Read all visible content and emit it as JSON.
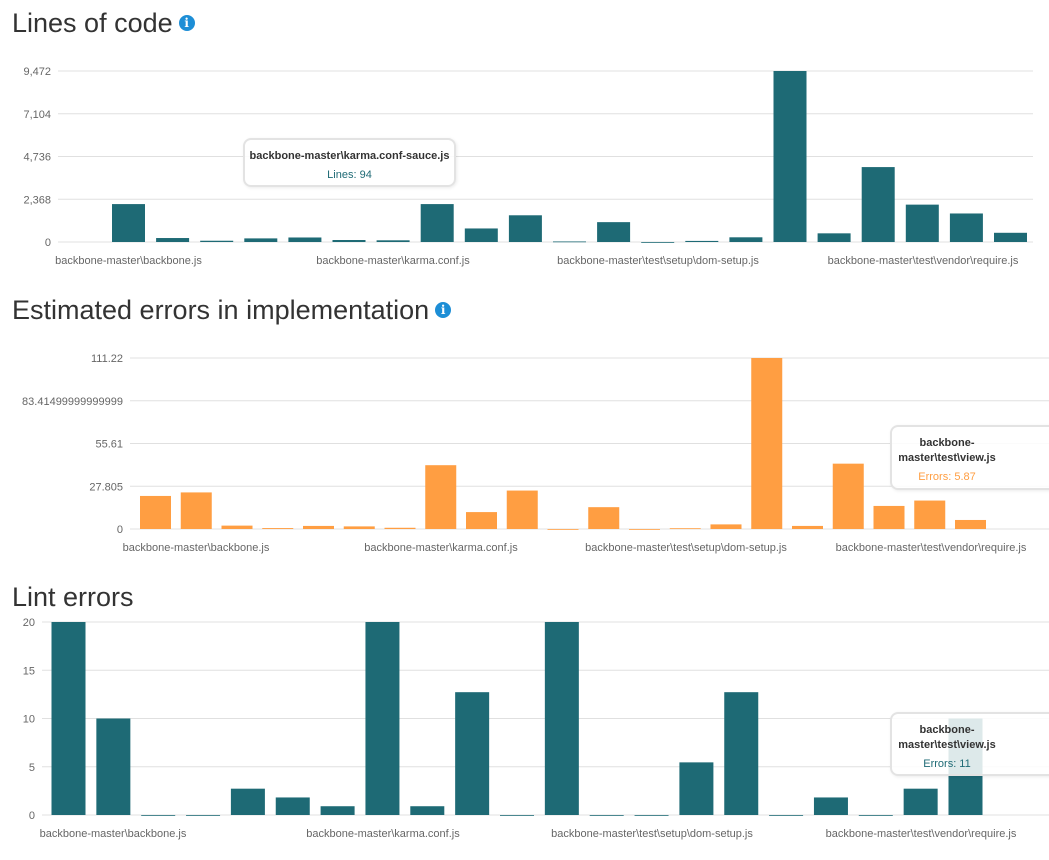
{
  "colors": {
    "teal": "#1e6a75",
    "orange": "#ff9e42",
    "info": "#1d8ed6"
  },
  "sections": {
    "loc": {
      "title": "Lines of code",
      "info_icon": "info-icon"
    },
    "err": {
      "title": "Estimated errors in implementation",
      "info_icon": "info-icon"
    },
    "lint": {
      "title": "Lint errors"
    }
  },
  "tooltips": {
    "loc": {
      "title": "backbone-master\\karma.conf-sauce.js",
      "label": "Lines: 94"
    },
    "err": {
      "title": "backbone-master\\test\\view.js",
      "label": "Errors: 5.87"
    },
    "lint": {
      "title": "backbone-master\\test\\view.js",
      "label": "Errors: 11"
    }
  },
  "chart_data": [
    {
      "type": "bar",
      "title": "Lines of code",
      "color": "#1e6a75",
      "y_ticks": [
        "9,472",
        "7,104",
        "4,736",
        "2,368",
        "0"
      ],
      "ylim": [
        0,
        9472
      ],
      "x_tick_labels": [
        "backbone-master\\backbone.js",
        "backbone-master\\karma.conf.js",
        "backbone-master\\test\\setup\\dom-setup.js",
        "backbone-master\\test\\vendor\\require.js"
      ],
      "categories": [
        "backbone-master\\backbone.js",
        "",
        "",
        "",
        "",
        "",
        "backbone-master\\karma.conf-sauce.js",
        "backbone-master\\karma.conf.js",
        "",
        "",
        "",
        "",
        "",
        "",
        "",
        "backbone-master\\test\\setup\\dom-setup.js",
        "",
        "",
        "",
        "",
        "",
        "backbone-master\\test\\vendor\\require.js"
      ],
      "values": [
        2100,
        220,
        70,
        200,
        250,
        110,
        94,
        2100,
        750,
        1480,
        30,
        1100,
        0,
        60,
        260,
        9472,
        480,
        4150,
        2070,
        1580,
        510,
        null
      ]
    },
    {
      "type": "bar",
      "title": "Estimated errors in implementation",
      "color": "#ff9e42",
      "y_ticks": [
        "111.22",
        "83.41499999999999",
        "55.61",
        "27.805",
        "0"
      ],
      "ylim": [
        0,
        111.22
      ],
      "x_tick_labels": [
        "backbone-master\\backbone.js",
        "backbone-master\\karma.conf.js",
        "backbone-master\\test\\setup\\dom-setup.js",
        "backbone-master\\test\\vendor\\require.js"
      ],
      "values": [
        21.5,
        23.8,
        2.2,
        0.6,
        2.0,
        1.7,
        0.8,
        41.5,
        11.0,
        25.0,
        0,
        14.2,
        0,
        0.5,
        3.0,
        111.22,
        2.0,
        42.5,
        15.0,
        18.5,
        5.87,
        null
      ]
    },
    {
      "type": "bar",
      "title": "Lint errors",
      "color": "#1e6a75",
      "y_ticks": [
        "20",
        "15",
        "10",
        "5",
        "0"
      ],
      "ylim": [
        0,
        22
      ],
      "x_tick_labels": [
        "backbone-master\\backbone.js",
        "backbone-master\\karma.conf.js",
        "backbone-master\\test\\setup\\dom-setup.js",
        "backbone-master\\test\\vendor\\require.js"
      ],
      "values": [
        22.5,
        11,
        0,
        0,
        3,
        2,
        1,
        22.5,
        1,
        14,
        0,
        22.5,
        0,
        0,
        6,
        14,
        0,
        2,
        0,
        3,
        11,
        null
      ]
    }
  ]
}
